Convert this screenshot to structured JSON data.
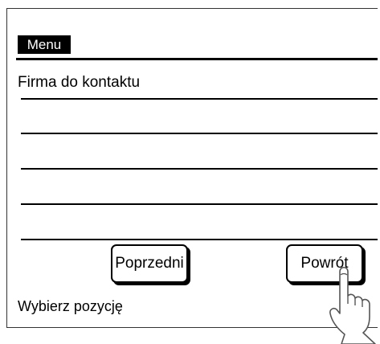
{
  "header": {
    "menu_label": "Menu"
  },
  "list": {
    "items": [
      "Firma do kontaktu",
      "",
      "",
      "",
      ""
    ]
  },
  "buttons": {
    "previous_label": "Poprzedni",
    "return_label": "Powrót"
  },
  "status": {
    "text": "Wybierz pozycję"
  },
  "icons": {
    "pointer": "hand-pointer-icon"
  }
}
